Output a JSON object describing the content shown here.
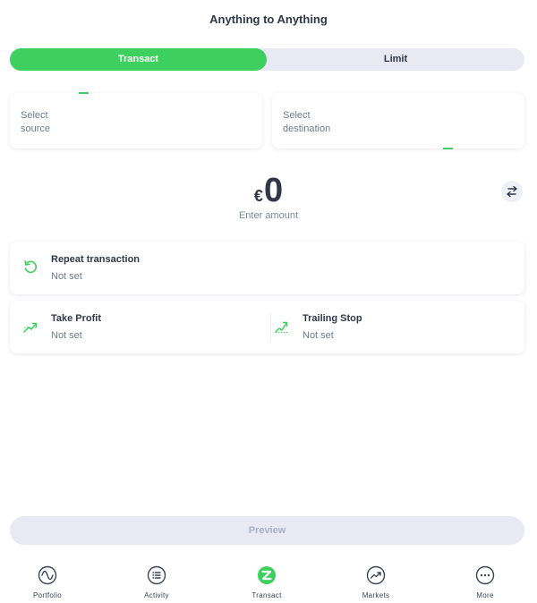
{
  "header": {
    "title": "Anything to Anything"
  },
  "tabs": {
    "transact": "Transact",
    "limit": "Limit"
  },
  "source": {
    "line1": "Select",
    "line2": "source"
  },
  "destination": {
    "line1": "Select",
    "line2": "destination"
  },
  "amount": {
    "currency": "€",
    "value": "0",
    "hint": "Enter amount"
  },
  "repeat": {
    "title": "Repeat transaction",
    "value": "Not set"
  },
  "take_profit": {
    "title": "Take Profit",
    "value": "Not set"
  },
  "trailing_stop": {
    "title": "Trailing Stop",
    "value": "Not set"
  },
  "preview": {
    "label": "Preview"
  },
  "nav": {
    "items": [
      {
        "label": "Portfolio",
        "icon": "portfolio-icon"
      },
      {
        "label": "Activity",
        "icon": "activity-icon"
      },
      {
        "label": "Transact",
        "icon": "transact-icon"
      },
      {
        "label": "Markets",
        "icon": "markets-icon"
      },
      {
        "label": "More",
        "icon": "more-icon"
      }
    ]
  },
  "colors": {
    "accent": "#3ed05e",
    "text": "#2f3748",
    "muted": "#6f7a8e",
    "segment_bg": "#e8e9f3"
  }
}
